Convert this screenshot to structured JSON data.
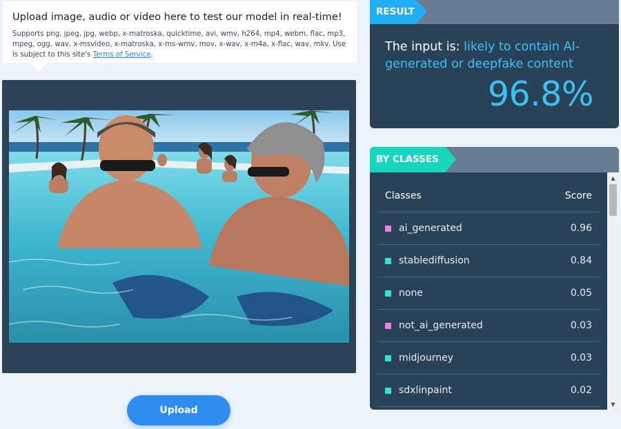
{
  "upload_info": {
    "title": "Upload image, audio or video here to test our model in real-time!",
    "description": "Supports png, jpeg, jpg, webp, x-matroska, quicktime, avi, wmv, h264, mp4, webm, flac, mp3, mpeg, ogg, wav, x-msvideo, x-matroska, x-ms-wmv, mov, x-wav, x-m4a, x-flac, wav, mkv. Use is subject to this site's ",
    "terms_link": "Terms of Service",
    "terms_suffix": "."
  },
  "upload_button": {
    "label": "Upload",
    "color": "#2f8cf0"
  },
  "result": {
    "tab_label": "RESULT",
    "prefix": "The input is: ",
    "verdict": "likely to contain AI-generated or deepfake content",
    "score": "96.8%",
    "accent_color": "#3cc0f5"
  },
  "classes": {
    "tab_label": "BY CLASSES",
    "header_class": "Classes",
    "header_score": "Score",
    "rows": [
      {
        "name": "ai_generated",
        "score": "0.96",
        "color": "#ee7ee8"
      },
      {
        "name": "stablediffusion",
        "score": "0.84",
        "color": "#35dfd2"
      },
      {
        "name": "none",
        "score": "0.05",
        "color": "#35dfd2"
      },
      {
        "name": "not_ai_generated",
        "score": "0.03",
        "color": "#ee7ee8"
      },
      {
        "name": "midjourney",
        "score": "0.03",
        "color": "#35dfd2"
      },
      {
        "name": "sdxlinpaint",
        "score": "0.02",
        "color": "#35dfd2"
      }
    ]
  },
  "icons": {
    "scroll_up": "scroll-up-arrow-icon",
    "scroll_down": "scroll-down-arrow-icon"
  }
}
